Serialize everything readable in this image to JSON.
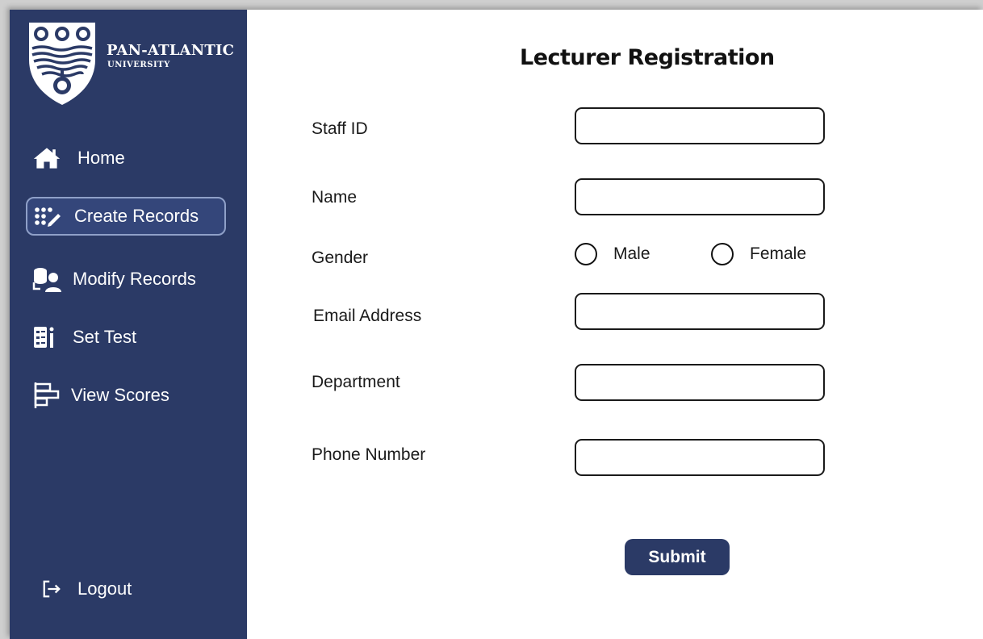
{
  "brand": {
    "name": "PAN-ATLANTIC",
    "sub": "UNIVERSITY"
  },
  "sidebar": {
    "items": [
      {
        "label": "Home",
        "icon": "home-icon"
      },
      {
        "label": "Create Records",
        "icon": "create-records-icon",
        "active": true
      },
      {
        "label": "Modify Records",
        "icon": "modify-records-icon"
      },
      {
        "label": "Set Test",
        "icon": "set-test-icon"
      },
      {
        "label": "View Scores",
        "icon": "view-scores-icon"
      }
    ],
    "logout": {
      "label": "Logout",
      "icon": "logout-icon"
    }
  },
  "form": {
    "title": "Lecturer Registration",
    "fields": {
      "staff_id": {
        "label": "Staff ID",
        "value": ""
      },
      "name": {
        "label": "Name",
        "value": ""
      },
      "gender": {
        "label": "Gender",
        "options": [
          "Male",
          "Female"
        ]
      },
      "email": {
        "label": "Email Address",
        "value": ""
      },
      "department": {
        "label": "Department",
        "value": ""
      },
      "phone": {
        "label": "Phone Number",
        "value": ""
      }
    },
    "submit_label": "Submit"
  },
  "colors": {
    "sidebar_bg": "#2b3a66",
    "accent": "#2b3a66",
    "active_border": "#8fa0c8"
  }
}
